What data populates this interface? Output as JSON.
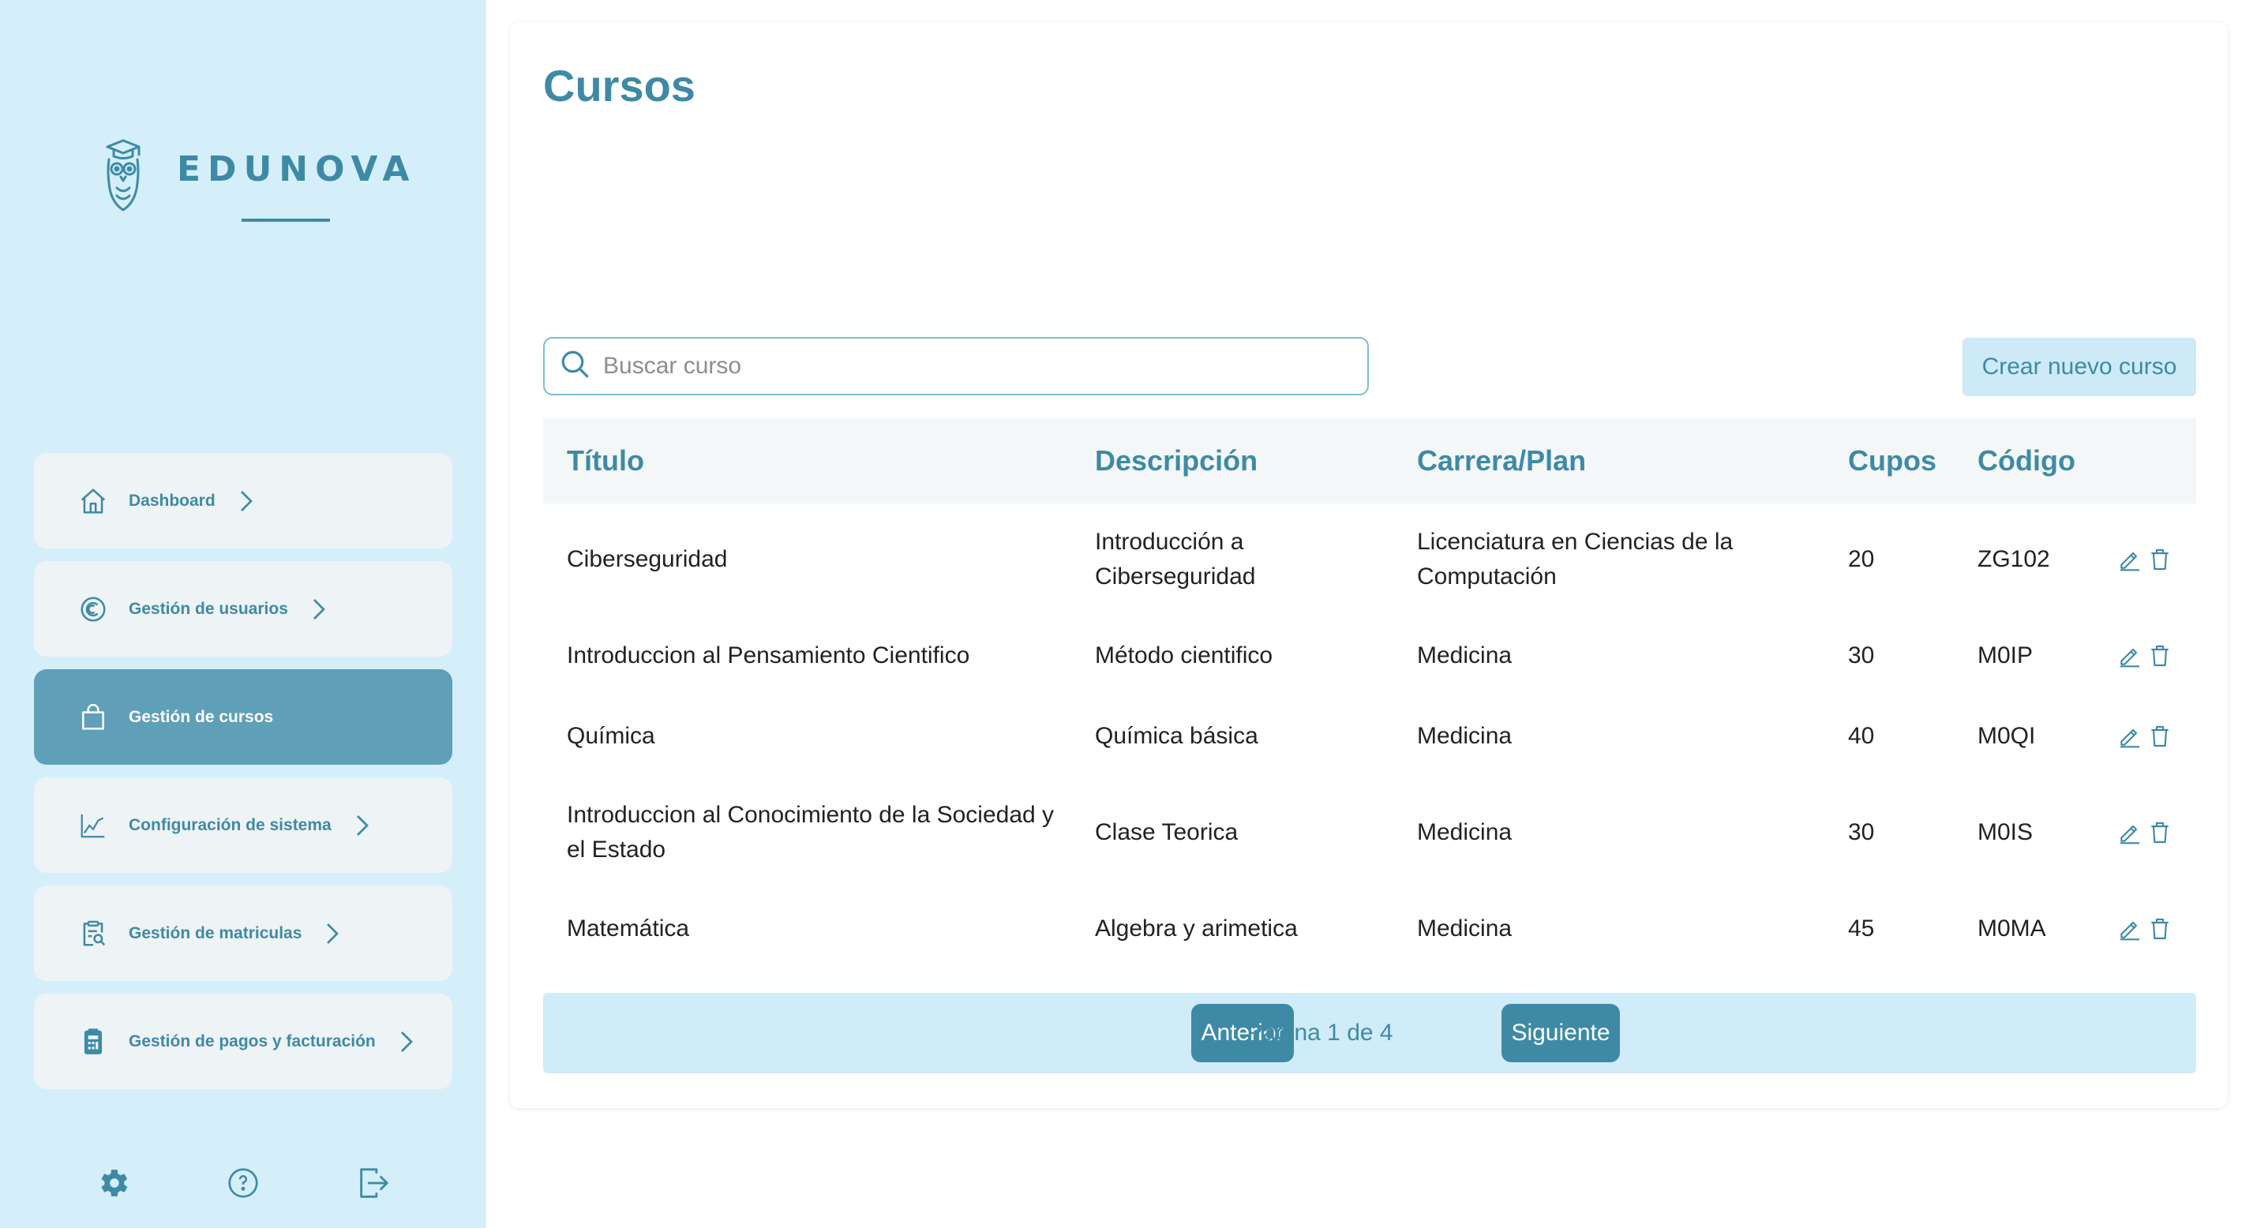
{
  "brand": {
    "name": "EDUNOVA"
  },
  "sidebar": {
    "items": [
      {
        "label": "Dashboard",
        "icon": "home-icon"
      },
      {
        "label": "Gestión de usuarios",
        "icon": "user-circle-icon"
      },
      {
        "label": "Gestión de cursos",
        "icon": "bag-icon",
        "active": true
      },
      {
        "label": "Configuración de sistema",
        "icon": "chart-line-icon"
      },
      {
        "label": "Gestión de matriculas",
        "icon": "clipboard-search-icon"
      },
      {
        "label": "Gestión de pagos y facturación",
        "icon": "calculator-icon"
      }
    ],
    "bottom_icons": [
      "gear-icon",
      "help-icon",
      "logout-icon"
    ]
  },
  "main": {
    "title": "Cursos",
    "search": {
      "placeholder": "Buscar curso",
      "value": ""
    },
    "create_button": "Crear nuevo curso",
    "table": {
      "headers": [
        "Título",
        "Descripción",
        "Carrera/Plan",
        "Cupos",
        "Código"
      ],
      "rows": [
        {
          "titulo": "Ciberseguridad",
          "descripcion": "Introducción a Ciberseguridad",
          "carrera": "Licenciatura en Ciencias de la Computación",
          "cupos": "20",
          "codigo": "ZG102"
        },
        {
          "titulo": "Introduccion al Pensamiento Cientifico",
          "descripcion": "Método cientifico",
          "carrera": "Medicina",
          "cupos": "30",
          "codigo": "M0IP"
        },
        {
          "titulo": "Química",
          "descripcion": "Química básica",
          "carrera": "Medicina",
          "cupos": "40",
          "codigo": "M0QI"
        },
        {
          "titulo": "Introduccion al Conocimiento de la Sociedad y el Estado",
          "descripcion": "Clase Teorica",
          "carrera": "Medicina",
          "cupos": "30",
          "codigo": "M0IS"
        },
        {
          "titulo": "Matemática",
          "descripcion": "Algebra y arimetica",
          "carrera": "Medicina",
          "cupos": "45",
          "codigo": "M0MA"
        }
      ]
    },
    "pagination": {
      "prev": "Anterior",
      "page_text": "Página 1 de 4",
      "next": "Siguiente"
    }
  },
  "colors": {
    "accent": "#3e8aa6",
    "sidebar_bg": "#d4effa",
    "active_item": "#5f9fb8",
    "nav_item_bg": "#eef3f6",
    "pagination_bg": "#d0ecf8"
  }
}
